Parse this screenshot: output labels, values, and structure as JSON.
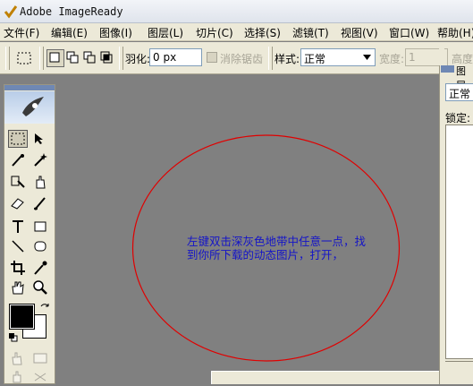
{
  "window": {
    "title": "Adobe ImageReady"
  },
  "menu": [
    {
      "label": "文件(F)"
    },
    {
      "label": "编辑(E)"
    },
    {
      "label": "图像(I)"
    },
    {
      "label": "图层(L)"
    },
    {
      "label": "切片(C)"
    },
    {
      "label": "选择(S)"
    },
    {
      "label": "滤镜(T)"
    },
    {
      "label": "视图(V)"
    },
    {
      "label": "窗口(W)"
    },
    {
      "label": "帮助(H)"
    }
  ],
  "options": {
    "feather_label": "羽化:",
    "feather_value": "0 px",
    "antialias_label": "消除锯齿",
    "style_label": "样式:",
    "style_value": "正常",
    "width_label": "宽度:",
    "width_value": "1",
    "height_label": "高度"
  },
  "panel": {
    "tab_label": "图层",
    "blend_value": "正常",
    "lock_label": "锁定:"
  },
  "canvas": {
    "hint_line1": "左键双击深灰色地带中任意一点，找",
    "hint_line2": "到你所下载的动态图片，打开，",
    "annotation_color": "#e00000",
    "hint_color": "#1414c8"
  },
  "colors": {
    "workspace": "#808080",
    "chrome": "#ece9d8",
    "foreground": "#000000",
    "background": "#ffffff"
  }
}
